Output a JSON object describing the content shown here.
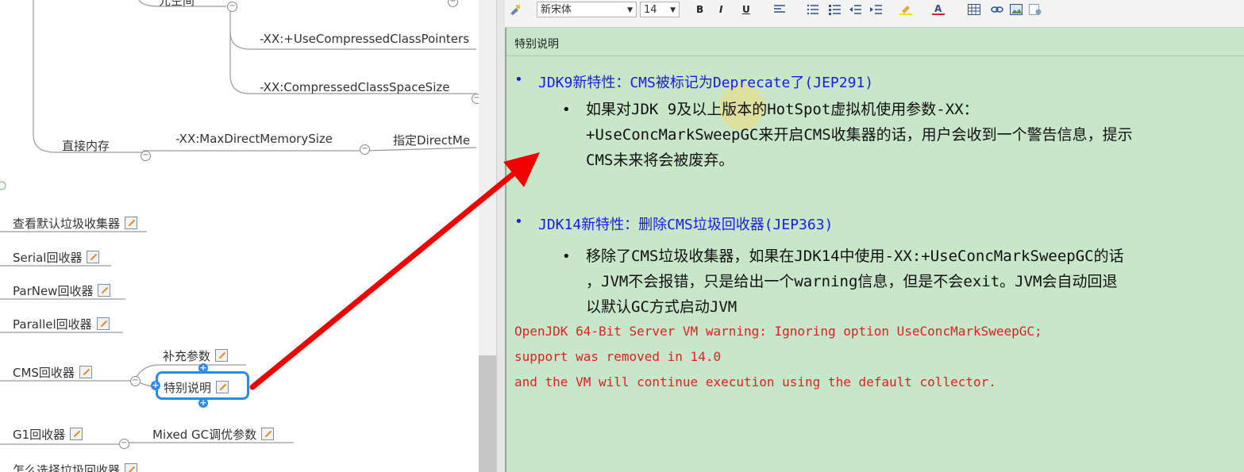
{
  "mindmap": {
    "top_partial": "元空间",
    "param_compressed_pointers": "-XX:+UseCompressedClassPointers",
    "param_class_space": "-XX:CompressedClassSpaceSize",
    "direct_memory_label": "直接内存",
    "param_max_direct": "-XX:MaxDirectMemorySize",
    "direct_desc": "指定DirectMe",
    "nodes": [
      "查看默认垃圾收集器",
      "Serial回收器",
      "ParNew回收器",
      "Parallel回收器",
      "CMS回收器",
      "G1回收器",
      "怎么选择垃圾回收器"
    ],
    "cms_children": [
      "补充参数",
      "特别说明"
    ],
    "g1_child": "Mixed GC调优参数"
  },
  "toolbar": {
    "font_name": "新宋体",
    "font_size": "14",
    "bold": "B",
    "italic": "I",
    "underline": "U"
  },
  "editor": {
    "title": "特别说明",
    "section1": {
      "heading": "JDK9新特性：CMS被标记为Deprecate了(JEP291)",
      "line1": "如果对JDK 9及以上版本的HotSpot虚拟机使用参数-XX：",
      "line2": "+UseConcMarkSweepGC来开启CMS收集器的话，用户会收到一个警告信息，提示",
      "line3": "CMS未来将会被废弃。"
    },
    "section2": {
      "heading": "JDK14新特性：删除CMS垃圾回收器(JEP363)",
      "line1": "移除了CMS垃圾收集器，如果在JDK14中使用-XX:+UseConcMarkSweepGC的话",
      "line2": "，JVM不会报错，只是给出一个warning信息，但是不会exit。JVM会自动回退",
      "line3": "以默认GC方式启动JVM"
    },
    "warning_lines": [
      "OpenJDK 64-Bit Server VM warning: Ignoring option UseConcMarkSweepGC;",
      "support was removed in 14.0",
      "and the VM will continue execution using the default collector."
    ]
  },
  "colors": {
    "editor_bg": "#c8e6c9",
    "heading_blue": "#1a1ae6",
    "warning_red": "#e02020",
    "selection_blue": "#2b8bea",
    "arrow_red": "#f20000"
  }
}
